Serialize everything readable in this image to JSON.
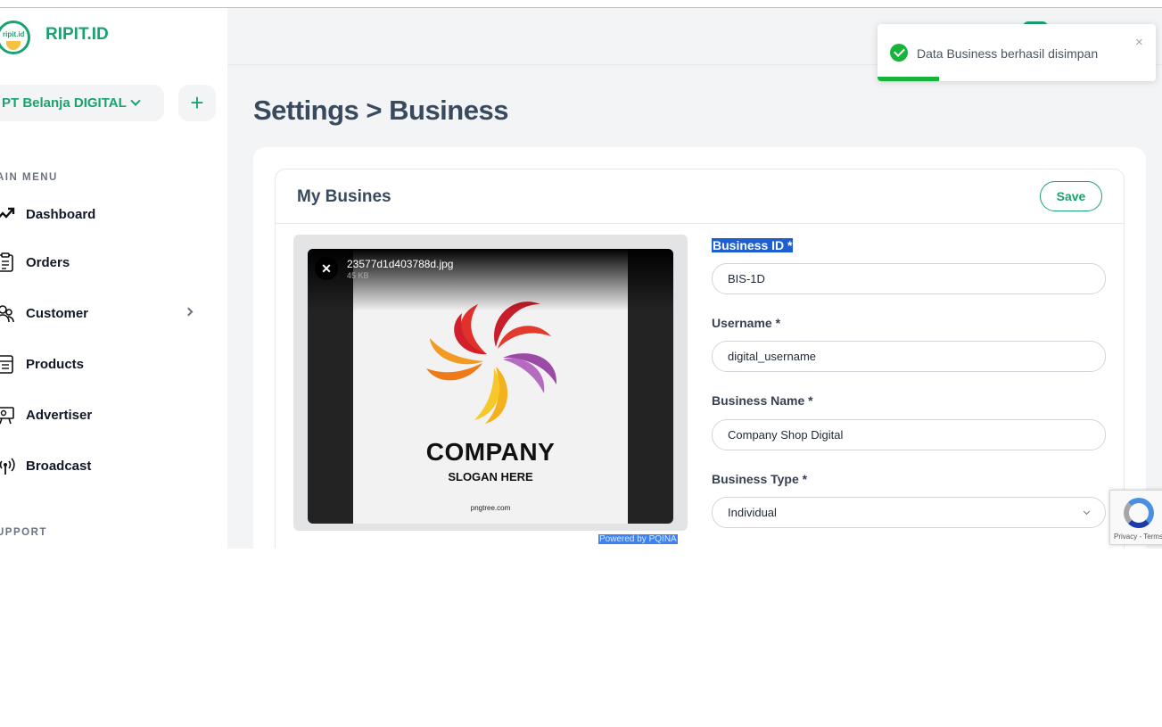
{
  "brand": {
    "logo_text": "ripit.id",
    "name": "RIPIT.ID"
  },
  "business_selector": {
    "label": "PT Belanja DIGITAL"
  },
  "sidebar": {
    "main_menu_label": "AIN MENU",
    "items": [
      {
        "label": "Dashboard",
        "icon": "trend-icon"
      },
      {
        "label": "Orders",
        "icon": "clipboard-icon"
      },
      {
        "label": "Customer",
        "icon": "users-icon"
      },
      {
        "label": "Products",
        "icon": "box-icon"
      },
      {
        "label": "Advertiser",
        "icon": "billboard-icon"
      },
      {
        "label": "Broadcast",
        "icon": "broadcast-icon"
      }
    ],
    "support_label": "UPPORT"
  },
  "page": {
    "title": "Settings > Business"
  },
  "card": {
    "title": "My Busines",
    "save_label": "Save"
  },
  "uploader": {
    "file_name": "23577d1d403788d.jpg",
    "file_size": "45 KB",
    "image_heading": "COMPANY",
    "image_slogan": "SLOGAN HERE",
    "image_watermark": "pngtree.com",
    "powered_by": "Powered by PQINA"
  },
  "form": {
    "business_id": {
      "label": "Business ID *",
      "value": "BIS-1D"
    },
    "username": {
      "label": "Username *",
      "value": "digital_username"
    },
    "business_name": {
      "label": "Business Name *",
      "value": "Company Shop Digital"
    },
    "business_type": {
      "label": "Business Type *",
      "value": "Individual"
    }
  },
  "toast": {
    "message": "Data Business berhasil disimpan",
    "close": "×",
    "progress": 0.22
  },
  "recaptcha": {
    "terms": "Privacy - Terms"
  },
  "colors": {
    "accent": "#1aa36f",
    "success": "#17b43a",
    "title": "#3a4a5e"
  }
}
